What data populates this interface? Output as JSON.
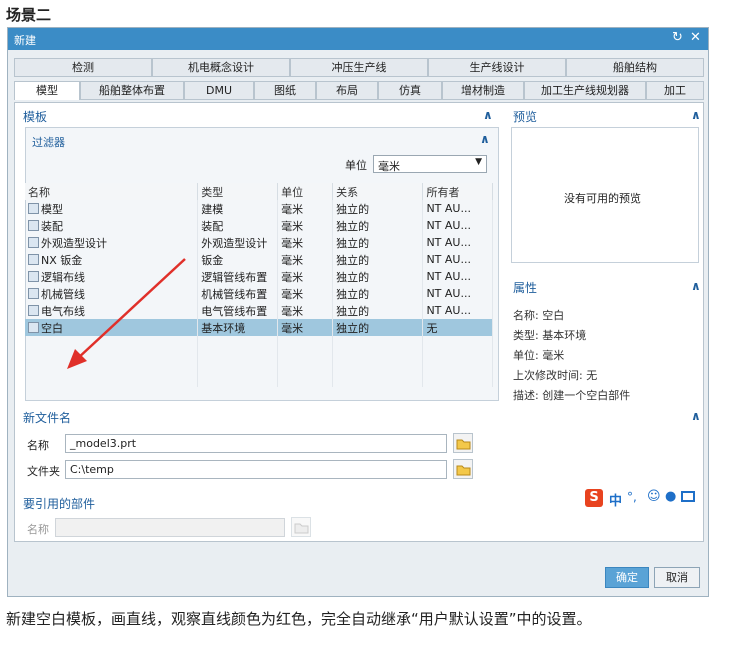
{
  "heading": "场景二",
  "dialog": {
    "title": "新建",
    "tabs_row1": [
      "检测",
      "机电概念设计",
      "冲压生产线",
      "生产线设计",
      "船舶结构"
    ],
    "tabs_row2": [
      "模型",
      "船舶整体布置",
      "DMU",
      "图纸",
      "布局",
      "仿真",
      "增材制造",
      "加工生产线规划器",
      "加工"
    ],
    "template_section": "模板",
    "filter_label": "过滤器",
    "unit_label": "单位",
    "unit_value": "毫米",
    "columns": [
      "名称",
      "类型",
      "单位",
      "关系",
      "所有者"
    ],
    "rows": [
      {
        "name": "模型",
        "type": "建模",
        "unit": "毫米",
        "rel": "独立的",
        "owner": "NT AU..."
      },
      {
        "name": "装配",
        "type": "装配",
        "unit": "毫米",
        "rel": "独立的",
        "owner": "NT AU..."
      },
      {
        "name": "外观造型设计",
        "type": "外观造型设计",
        "unit": "毫米",
        "rel": "独立的",
        "owner": "NT AU..."
      },
      {
        "name": "NX 钣金",
        "type": "钣金",
        "unit": "毫米",
        "rel": "独立的",
        "owner": "NT AU..."
      },
      {
        "name": "逻辑布线",
        "type": "逻辑管线布置",
        "unit": "毫米",
        "rel": "独立的",
        "owner": "NT AU..."
      },
      {
        "name": "机械管线",
        "type": "机械管线布置",
        "unit": "毫米",
        "rel": "独立的",
        "owner": "NT AU..."
      },
      {
        "name": "电气布线",
        "type": "电气管线布置",
        "unit": "毫米",
        "rel": "独立的",
        "owner": "NT AU..."
      },
      {
        "name": "空白",
        "type": "基本环境",
        "unit": "毫米",
        "rel": "独立的",
        "owner": "无"
      }
    ],
    "preview_section": "预览",
    "preview_empty": "没有可用的预览",
    "props_section": "属性",
    "props": {
      "name": "名称: 空白",
      "type": "类型: 基本环境",
      "unit": "单位: 毫米",
      "modified": "上次修改时间: 无",
      "desc": "描述: 创建一个空白部件"
    },
    "newfile_section": "新文件名",
    "name_label": "名称",
    "name_value": "_model3.prt",
    "folder_label": "文件夹",
    "folder_value": "C:\\temp",
    "ref_section": "要引用的部件",
    "ref_name_label": "名称",
    "ime": {
      "logo": "S",
      "lang": "中",
      "punct": "°,"
    },
    "ok": "确定",
    "cancel": "取消"
  },
  "caption": "新建空白模板，画直线，观察直线颜色为红色，完全自动继承“用户默认设置”中的设置。"
}
